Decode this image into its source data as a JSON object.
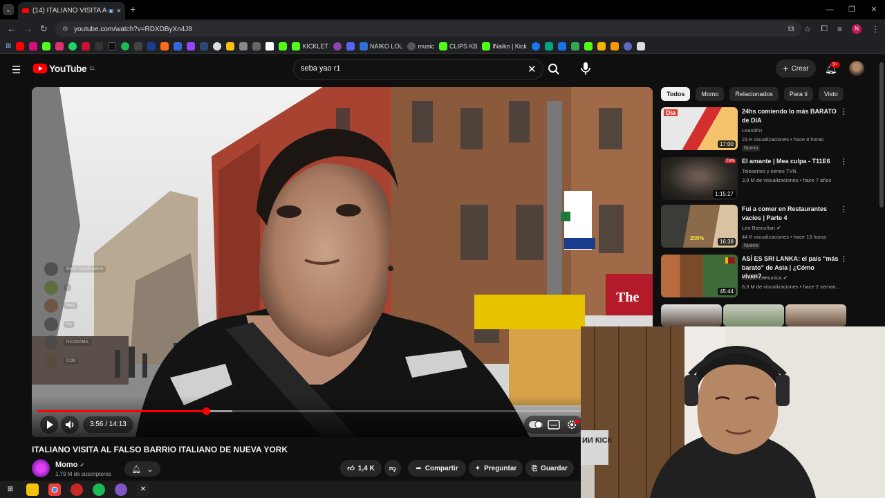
{
  "browser": {
    "tab_title": "(14) ITALIANO VISITA AL FA",
    "tab_close": "×",
    "new_tab": "+",
    "url": "youtube.com/watch?v=RDXDByXn4J8",
    "bookmarks": [
      {
        "label": "KICKLET",
        "color": "#53fc18"
      },
      {
        "label": "NAIKO LOL",
        "color": "#2f6fd6"
      },
      {
        "label": "music",
        "color": "#555555"
      },
      {
        "label": "CLIPS KB",
        "color": "#53fc18"
      },
      {
        "label": "lNaiko | Kick",
        "color": "#53fc18"
      }
    ]
  },
  "youtube": {
    "logo_text": "YouTube",
    "region": "CL",
    "search_value": "seba yao r1",
    "create_label": "Crear",
    "notification_count": "9+"
  },
  "player": {
    "time": "3:56 / 14:13",
    "progress_fraction": 0.2768,
    "buffer_fraction": 0.32,
    "overlay_names": [
      "Bordi RickyBrandon",
      "L",
      "Matt",
      "Ne",
      "NICOYAMIL",
      "COB"
    ]
  },
  "video": {
    "title": "ITALIANO VISITA AL FALSO BARRIO ITALIANO DE NUEVA YORK",
    "channel": "Momo",
    "subscribers": "1,79 M de suscriptores",
    "likes": "1,4 K",
    "share_label": "Compartir",
    "ask_label": "Preguntar",
    "save_label": "Guardar"
  },
  "chips": [
    "Todos",
    "Momo",
    "Relacionados",
    "Para ti",
    "Visto"
  ],
  "recommendations": [
    {
      "title": "24hs comiendo lo más BARATO de DIA",
      "channel": "Leandrin",
      "meta": "23 K visualizaciones • hace 8 horas",
      "badge": "Nuevo",
      "duration": "17:00"
    },
    {
      "title": "El amante | Mea culpa - T11E6",
      "channel": "Teleseries y series TVN",
      "meta": "3,9 M de visualizaciones • hace 7 años",
      "badge": "",
      "duration": "1:15:27"
    },
    {
      "title": "Fui a comer en Restaurantes vacíos | Parte 4",
      "channel": "Leo Bascuñan",
      "meta": "44 K visualizaciones • hace 13 horas",
      "badge": "Nuevo",
      "duration": "16:38"
    },
    {
      "title": "ASÍ ES SRI LANKA: el país “más barato” de Asia | ¿Cómo viven?...",
      "channel": "Luisito Comunica",
      "meta": "6,3 M de visualizaciones • hace 2 seman...",
      "badge": "",
      "duration": "45:44"
    }
  ],
  "colors": {
    "accent": "#ff0000",
    "background": "#0f0f0f",
    "chip_bg": "#272727"
  }
}
